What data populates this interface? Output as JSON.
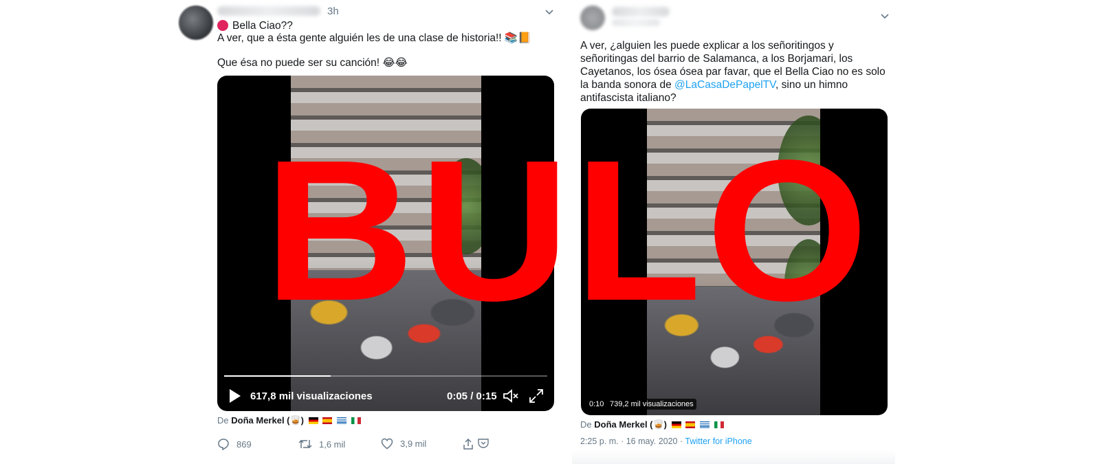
{
  "tweet_left": {
    "time": "3h",
    "line1": "Bella Ciao??",
    "line2": "A ver, que a ésta gente alguién les de una clase de historia!! 📚📙",
    "line3": "Que ésa no puede ser su canción! 😂😂",
    "video": {
      "views": "617,8 mil visualizaciones",
      "time": "0:05 / 0:15",
      "progress": 0.33
    },
    "from_prefix": "De",
    "from_name": "Doña Merkel (🥃)",
    "actions": {
      "replies": "869",
      "retweets": "1,6 mil",
      "likes": "3,9 mil"
    }
  },
  "tweet_right": {
    "text_before": "A ver, ¿alguien les puede explicar a los señoritingos y señoritingas del barrio de Salamanca, a los Borjamari, los Cayetanos, los ósea ósea par favar, que el Bella Ciao no es solo la banda sonora de ",
    "mention": "@LaCasaDePapelTV",
    "text_after": ", sino un himno antifascista italiano?",
    "video": {
      "time": "0:10",
      "views": "739,2 mil visualizaciones"
    },
    "from_prefix": "De",
    "from_name": "Doña Merkel (🥃)",
    "timestamp": "2:25 p. m. · 16 may. 2020 · ",
    "source": "Twitter for iPhone"
  },
  "overlay": {
    "stamp": "BULO",
    "color": "#ff0000"
  },
  "colors": {
    "link": "#1da1f2",
    "muted": "#657786"
  },
  "icons": [
    "reply-icon",
    "retweet-icon",
    "like-icon",
    "share-icon",
    "play-icon",
    "volume-icon",
    "fullscreen-icon",
    "chevron-down-icon"
  ]
}
